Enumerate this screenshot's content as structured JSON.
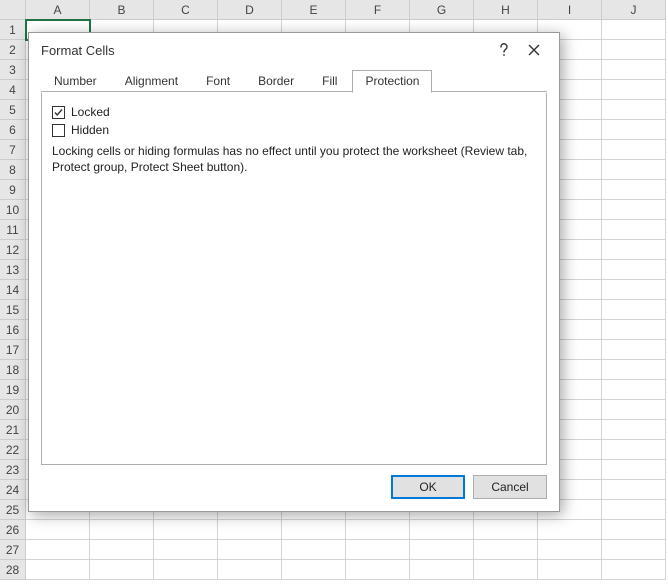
{
  "columns": [
    "A",
    "B",
    "C",
    "D",
    "E",
    "F",
    "G",
    "H",
    "I",
    "J"
  ],
  "row_count": 28,
  "selected_cell": {
    "row": 1,
    "col": 0
  },
  "dialog": {
    "title": "Format Cells",
    "tabs": [
      {
        "label": "Number"
      },
      {
        "label": "Alignment"
      },
      {
        "label": "Font"
      },
      {
        "label": "Border"
      },
      {
        "label": "Fill"
      },
      {
        "label": "Protection"
      }
    ],
    "active_tab": 5,
    "protection": {
      "locked_label": "Locked",
      "locked_checked": true,
      "hidden_label": "Hidden",
      "hidden_checked": false,
      "hint": "Locking cells or hiding formulas has no effect until you protect the worksheet (Review tab, Protect group, Protect Sheet button)."
    },
    "buttons": {
      "ok": "OK",
      "cancel": "Cancel"
    }
  }
}
